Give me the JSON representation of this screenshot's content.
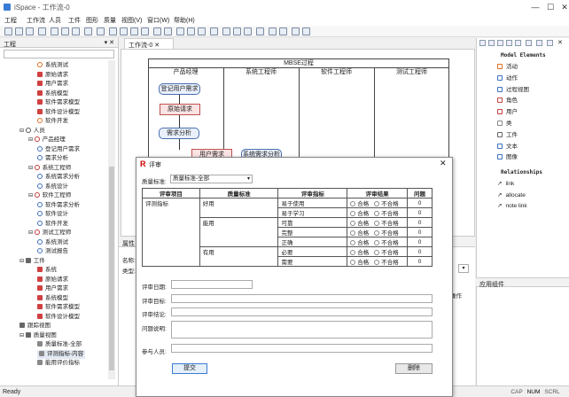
{
  "window": {
    "title": "iSpace - 工作流-0",
    "min": "—",
    "max": "☐",
    "close": "✕"
  },
  "menu": [
    "工程",
    "工作流",
    "人员",
    "工件",
    "图形",
    "质量",
    "视图(V)",
    "窗口(W)",
    "帮助(H)"
  ],
  "left_panel": {
    "title": "工程",
    "tree": [
      {
        "label": "系统测试",
        "indent": 4,
        "icon": "#e07020",
        "type": "ring"
      },
      {
        "label": "原始请求",
        "indent": 4,
        "icon": "#d04040",
        "type": "sq"
      },
      {
        "label": "用户需求",
        "indent": 4,
        "icon": "#d04040",
        "type": "sq"
      },
      {
        "label": "系统模型",
        "indent": 4,
        "icon": "#d04040",
        "type": "sq"
      },
      {
        "label": "软件需求模型",
        "indent": 4,
        "icon": "#d04040",
        "type": "sq"
      },
      {
        "label": "软件设计模型",
        "indent": 4,
        "icon": "#d04040",
        "type": "sq"
      },
      {
        "label": "软件开发",
        "indent": 4,
        "icon": "#e07020",
        "type": "ring"
      },
      {
        "label": "人员",
        "indent": 2,
        "icon": "#555",
        "type": "ring",
        "exp": "⊟"
      },
      {
        "label": "产品经理",
        "indent": 3,
        "icon": "#c04040",
        "type": "ring",
        "exp": "⊟"
      },
      {
        "label": "登记用户需求",
        "indent": 4,
        "icon": "#4070c0",
        "type": "ring"
      },
      {
        "label": "需求分析",
        "indent": 4,
        "icon": "#4070c0",
        "type": "ring"
      },
      {
        "label": "系统工程师",
        "indent": 3,
        "icon": "#c04040",
        "type": "ring",
        "exp": "⊟"
      },
      {
        "label": "系统需求分析",
        "indent": 4,
        "icon": "#4070c0",
        "type": "ring"
      },
      {
        "label": "系统设计",
        "indent": 4,
        "icon": "#4070c0",
        "type": "ring"
      },
      {
        "label": "软件工程师",
        "indent": 3,
        "icon": "#c04040",
        "type": "ring",
        "exp": "⊟"
      },
      {
        "label": "软件需求分析",
        "indent": 4,
        "icon": "#4070c0",
        "type": "ring"
      },
      {
        "label": "软件设计",
        "indent": 4,
        "icon": "#4070c0",
        "type": "ring"
      },
      {
        "label": "软件开发",
        "indent": 4,
        "icon": "#4070c0",
        "type": "ring"
      },
      {
        "label": "测试工程师",
        "indent": 3,
        "icon": "#c04040",
        "type": "ring",
        "exp": "⊟"
      },
      {
        "label": "系统测试",
        "indent": 4,
        "icon": "#4070c0",
        "type": "ring"
      },
      {
        "label": "测试报告",
        "indent": 4,
        "icon": "#4070c0",
        "type": "ring"
      },
      {
        "label": "工件",
        "indent": 2,
        "icon": "#666",
        "type": "sq",
        "exp": "⊟"
      },
      {
        "label": "系统",
        "indent": 4,
        "icon": "#d04040",
        "type": "sq"
      },
      {
        "label": "原始请求",
        "indent": 4,
        "icon": "#d04040",
        "type": "sq"
      },
      {
        "label": "用户需求",
        "indent": 4,
        "icon": "#d04040",
        "type": "sq"
      },
      {
        "label": "系统模型",
        "indent": 4,
        "icon": "#d04040",
        "type": "sq"
      },
      {
        "label": "软件需求模型",
        "indent": 4,
        "icon": "#d04040",
        "type": "sq"
      },
      {
        "label": "软件设计模型",
        "indent": 4,
        "icon": "#d04040",
        "type": "sq"
      },
      {
        "label": "跟踪视图",
        "indent": 2,
        "icon": "#666",
        "type": "sq"
      },
      {
        "label": "质量视图",
        "indent": 2,
        "icon": "#666",
        "type": "sq",
        "exp": "⊟"
      },
      {
        "label": "质量标准-全部",
        "indent": 4,
        "icon": "#888",
        "type": "sq"
      },
      {
        "label": "评测指标-内容",
        "indent": 4,
        "icon": "#888",
        "type": "sq",
        "selected": true
      },
      {
        "label": "能用评价指标",
        "indent": 4,
        "icon": "#888",
        "type": "sq"
      }
    ]
  },
  "editor": {
    "tab": "工作流-0",
    "diagram_title": "MBSE过程",
    "lanes": [
      "产品经理",
      "系统工程师",
      "软件工程师",
      "测试工程师"
    ],
    "nodes": {
      "n1": "登记用户需求",
      "n2": "原始请求",
      "n3": "需求分析",
      "n4": "用户需求",
      "n5": "系统需求分析"
    }
  },
  "props": {
    "title": "属性",
    "name_label": "名称:",
    "type_label": "类型:",
    "col": "操作"
  },
  "palette": {
    "section1": "Model Elements",
    "items": [
      {
        "label": "活动",
        "color": "#e07020"
      },
      {
        "label": "动作",
        "color": "#4070c0"
      },
      {
        "label": "过程视图",
        "color": "#4070c0"
      },
      {
        "label": "角色",
        "color": "#c04040"
      },
      {
        "label": "用户",
        "color": "#c04040"
      },
      {
        "label": "类",
        "color": "#888888"
      },
      {
        "label": "工件",
        "color": "#666666"
      },
      {
        "label": "文本",
        "color": "#4070c0"
      },
      {
        "label": "图像",
        "color": "#4070c0"
      }
    ],
    "section2": "Relationships",
    "rels": [
      {
        "label": "link",
        "glyph": "↗"
      },
      {
        "label": "allocate",
        "glyph": "↗"
      },
      {
        "label": "note link",
        "glyph": "↗"
      }
    ],
    "app_title": "应用组件"
  },
  "dialog": {
    "title": "评审",
    "std_label": "质量标准:",
    "std_value": "质量标准-全部",
    "headers": [
      "评审项目",
      "质量标准",
      "评审指标",
      "评审结果",
      "问题"
    ],
    "item": "评测指标",
    "rows": [
      {
        "std": "好用",
        "metric": "易于使用",
        "count": "0"
      },
      {
        "std": "",
        "metric": "易于学习",
        "count": "0"
      },
      {
        "std": "能用",
        "metric": "可靠",
        "count": "0"
      },
      {
        "std": "",
        "metric": "完整",
        "count": "0"
      },
      {
        "std": "",
        "metric": "正确",
        "count": "0"
      },
      {
        "std": "有用",
        "metric": "必要",
        "count": "0"
      },
      {
        "std": "",
        "metric": "需要",
        "count": "0"
      }
    ],
    "pass": "合格",
    "fail": "不合格",
    "fields": {
      "date": "评审日期:",
      "target": "评审目标:",
      "conclusion": "评审结论:",
      "issue": "问题说明:",
      "people": "参与人员:"
    },
    "submit": "提交",
    "delete": "删除"
  },
  "status": {
    "ready": "Ready",
    "cap": "CAP",
    "num": "NUM",
    "scrl": "SCRL"
  }
}
